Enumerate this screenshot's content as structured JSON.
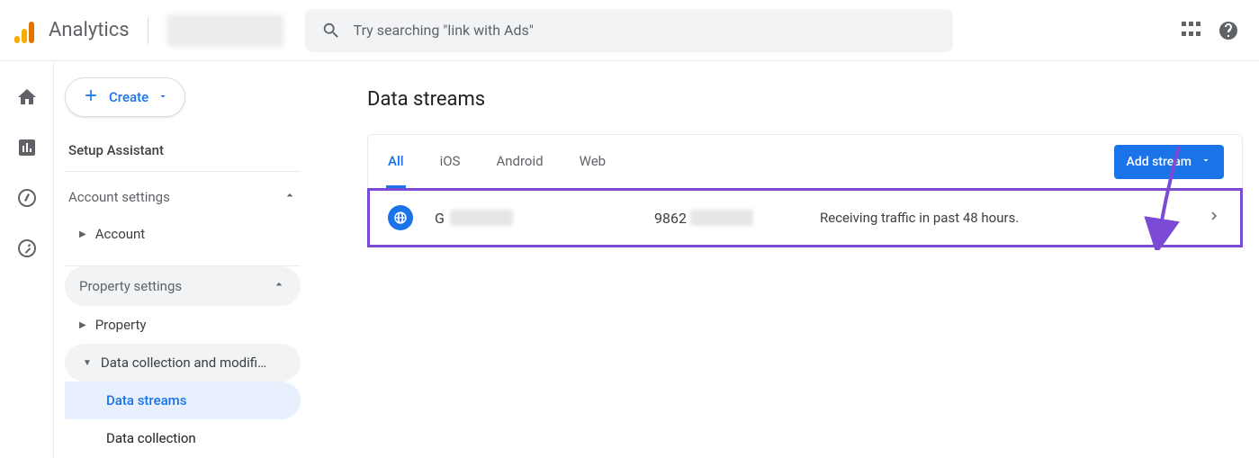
{
  "header": {
    "product_name": "Analytics",
    "search_placeholder": "Try searching \"link with Ads\""
  },
  "sidebar": {
    "create_label": "Create",
    "setup_assistant": "Setup Assistant",
    "account_settings": "Account settings",
    "account": "Account",
    "property_settings": "Property settings",
    "property": "Property",
    "data_collection_mod": "Data collection and modifica...",
    "data_streams": "Data streams",
    "data_collection": "Data collection"
  },
  "main": {
    "page_title": "Data streams",
    "tabs": {
      "all": "All",
      "ios": "iOS",
      "android": "Android",
      "web": "Web"
    },
    "add_stream_label": "Add stream",
    "stream": {
      "name_first_letter": "G",
      "id_prefix": "9862",
      "status": "Receiving traffic in past 48 hours."
    }
  }
}
